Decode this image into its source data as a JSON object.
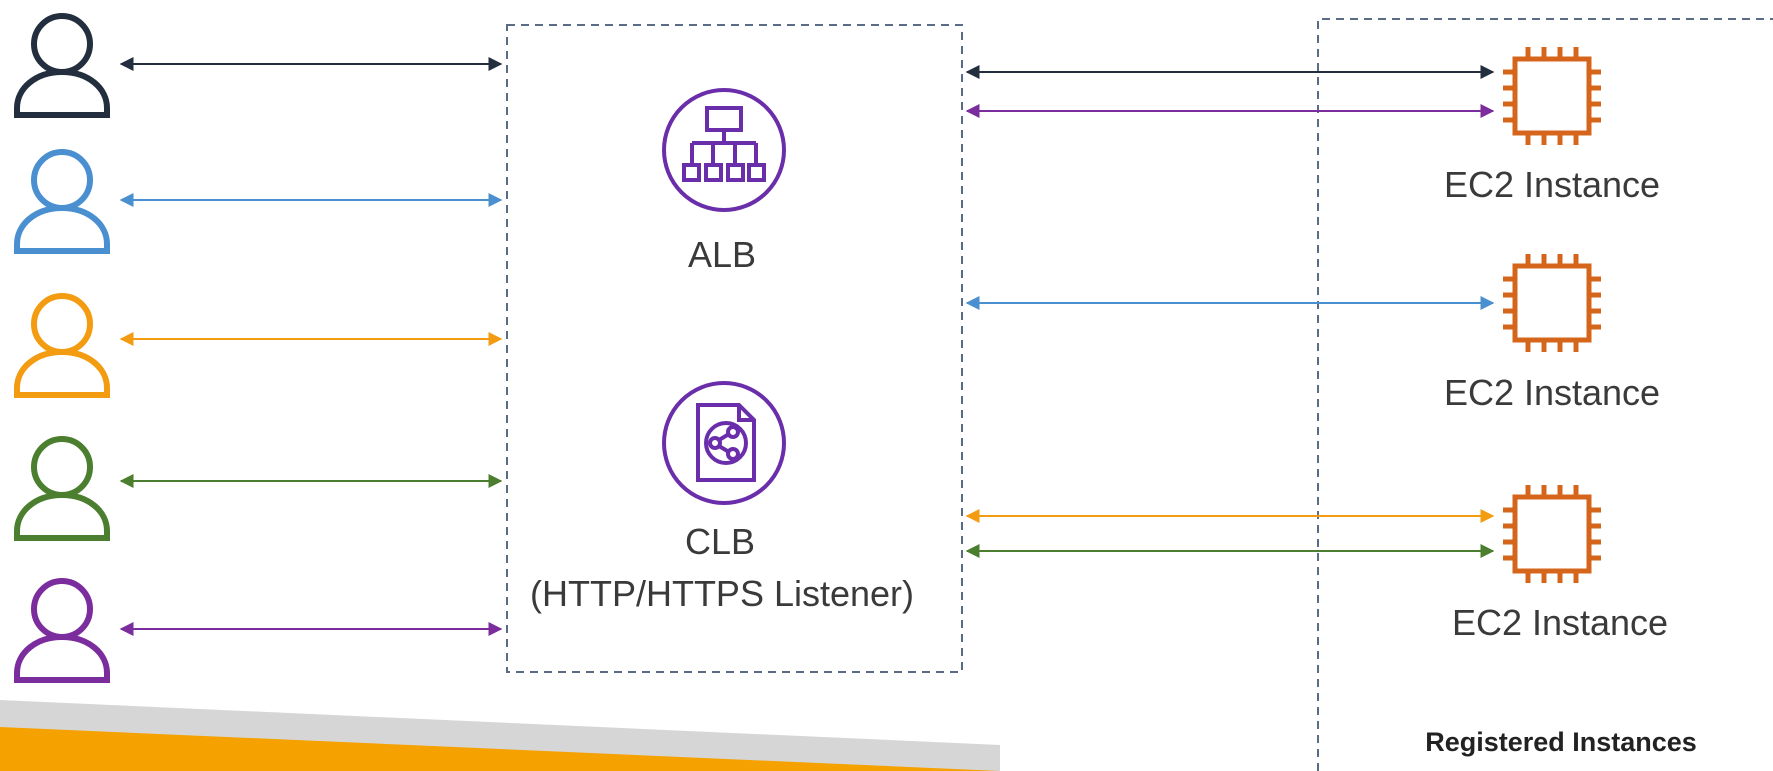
{
  "colors": {
    "user1": "#232f3e",
    "user2": "#4a90d0",
    "user3": "#f39c12",
    "user4": "#4b7f2f",
    "user5": "#7b2d9e",
    "lb_icon": "#6a2eab",
    "ec2_icon": "#d4651b",
    "dashed_border": "#5a6b85",
    "footer_orange": "#f5a100",
    "footer_gray": "#d6d6d6"
  },
  "users": [
    {
      "icon": "user-icon",
      "color_key": "user1"
    },
    {
      "icon": "user-icon",
      "color_key": "user2"
    },
    {
      "icon": "user-icon",
      "color_key": "user3"
    },
    {
      "icon": "user-icon",
      "color_key": "user4"
    },
    {
      "icon": "user-icon",
      "color_key": "user5"
    }
  ],
  "load_balancers": {
    "alb": {
      "label": "ALB",
      "icon": "application-load-balancer-icon"
    },
    "clb": {
      "label": "CLB",
      "sublabel": "(HTTP/HTTPS Listener)",
      "icon": "classic-load-balancer-icon"
    }
  },
  "instances": [
    {
      "label": "EC2 Instance",
      "icon": "ec2-chip-icon"
    },
    {
      "label": "EC2 Instance",
      "icon": "ec2-chip-icon"
    },
    {
      "label": "EC2 Instance",
      "icon": "ec2-chip-icon"
    }
  ],
  "registered_group": {
    "label": "Registered Instances"
  },
  "connections": {
    "user_to_lb": [
      "user1",
      "user2",
      "user3",
      "user4",
      "user5"
    ],
    "lb_to_instance": [
      {
        "color_key": "user1",
        "instance": 1
      },
      {
        "color_key": "user5",
        "instance": 1
      },
      {
        "color_key": "user2",
        "instance": 2
      },
      {
        "color_key": "user3",
        "instance": 3
      },
      {
        "color_key": "user4",
        "instance": 3
      }
    ]
  }
}
